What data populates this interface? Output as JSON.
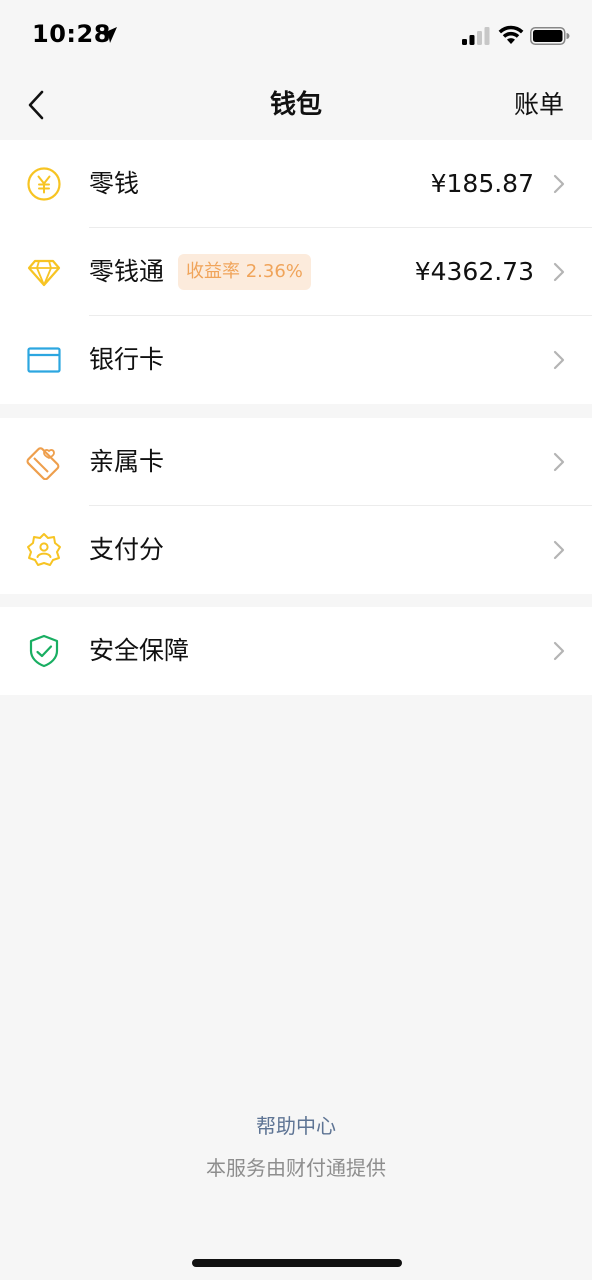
{
  "status_bar": {
    "time": "10:28",
    "icons": [
      "location-arrow-icon",
      "signal-icon",
      "wifi-icon",
      "battery-icon"
    ]
  },
  "nav": {
    "back_icon": "chevron-left-icon",
    "title": "钱包",
    "bill_label": "账单"
  },
  "sections": [
    {
      "rows": [
        {
          "label": "零钱",
          "value": "¥185.87",
          "icon": "yuan-coin-icon"
        },
        {
          "label": "零钱通",
          "badge": "收益率 2.36%",
          "value": "¥4362.73",
          "icon": "diamond-icon"
        },
        {
          "label": "银行卡",
          "value": "",
          "icon": "bank-card-icon"
        }
      ]
    },
    {
      "rows": [
        {
          "label": "亲属卡",
          "value": "",
          "icon": "family-card-icon"
        },
        {
          "label": "支付分",
          "value": "",
          "icon": "pay-score-icon"
        }
      ]
    },
    {
      "rows": [
        {
          "label": "安全保障",
          "value": "",
          "icon": "security-shield-icon"
        }
      ]
    }
  ],
  "footer": {
    "help_center": "帮助中心",
    "provider": "本服务由财付通提供"
  },
  "colors": {
    "background": "#f6f6f6",
    "coin_yellow": "#f7c423",
    "badge_bg": "#fcebdc",
    "badge_text": "#f0a45a",
    "card_blue": "#2ca6e0",
    "family_orange": "#ee9f4d",
    "shield_green": "#19ae62",
    "link_blue": "#5e7494"
  }
}
